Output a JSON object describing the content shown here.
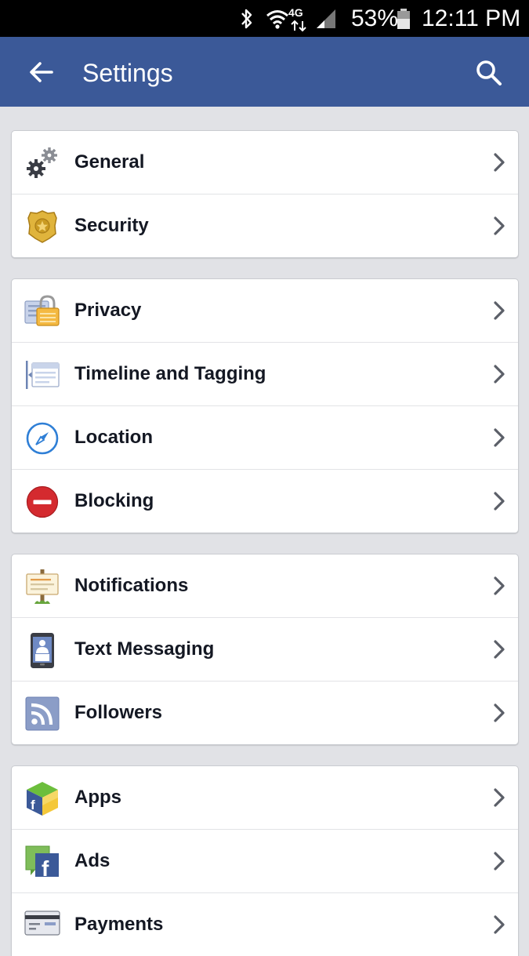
{
  "status_bar": {
    "battery": "53%",
    "time": "12:11 PM",
    "network": "4G",
    "icons": [
      "bluetooth-icon",
      "wifi-icon",
      "network-4g-icon",
      "cell-signal-icon",
      "battery-icon"
    ]
  },
  "app_bar": {
    "title": "Settings",
    "back_icon": "back-arrow-icon",
    "search_icon": "search-icon",
    "color": "#3b5998"
  },
  "sections": [
    {
      "items": [
        {
          "label": "General",
          "icon": "gear-icon"
        },
        {
          "label": "Security",
          "icon": "shield-badge-icon"
        }
      ]
    },
    {
      "items": [
        {
          "label": "Privacy",
          "icon": "padlock-icon"
        },
        {
          "label": "Timeline and Tagging",
          "icon": "timeline-icon"
        },
        {
          "label": "Location",
          "icon": "compass-icon"
        },
        {
          "label": "Blocking",
          "icon": "blocked-icon"
        }
      ]
    },
    {
      "items": [
        {
          "label": "Notifications",
          "icon": "signpost-icon"
        },
        {
          "label": "Text Messaging",
          "icon": "phone-icon"
        },
        {
          "label": "Followers",
          "icon": "rss-icon"
        }
      ]
    },
    {
      "items": [
        {
          "label": "Apps",
          "icon": "app-cube-icon"
        },
        {
          "label": "Ads",
          "icon": "facebook-ads-icon"
        },
        {
          "label": "Payments",
          "icon": "credit-card-icon"
        }
      ]
    }
  ]
}
